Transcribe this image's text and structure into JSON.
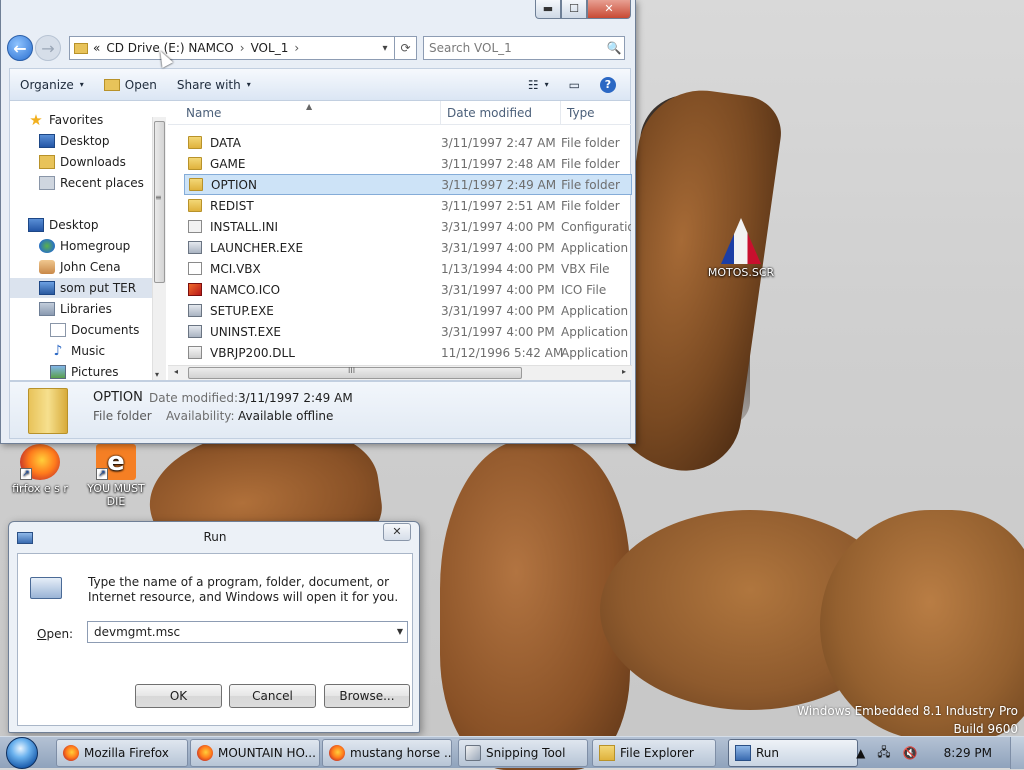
{
  "desktop": {
    "watermark": {
      "edition": "Windows Embedded 8.1 Industry Pro",
      "build": "Build 9600"
    },
    "icons": [
      {
        "label": "firfox e s r",
        "icon": "firefox-icon"
      },
      {
        "label": "YOU MUST DIE",
        "icon": "ie-icon"
      },
      {
        "label": "MOTOS.SCR",
        "icon": "screensaver-icon"
      }
    ]
  },
  "explorer": {
    "title_buttons": {
      "minimize": "▬",
      "maximize": "☐",
      "close": "✕"
    },
    "address": {
      "overflow": "«",
      "crumbs": [
        "CD Drive (E:) NAMCO",
        "VOL_1"
      ],
      "separator": "›",
      "dropdown": "▾",
      "refresh": "⟳"
    },
    "search": {
      "placeholder": "Search VOL_1",
      "icon": "🔍"
    },
    "toolbar": {
      "organize": "Organize",
      "open": "Open",
      "share_with": "Share with",
      "caret": "▾",
      "view_icon": "☷",
      "pane_icon": "▭",
      "help": "?"
    },
    "nav": {
      "favorites": "Favorites",
      "desktop": "Desktop",
      "downloads": "Downloads",
      "recent_places": "Recent places",
      "desktop2": "Desktop",
      "homegroup": "Homegroup",
      "user": "John Cena",
      "computer": "som put TER",
      "libraries": "Libraries",
      "documents": "Documents",
      "music": "Music",
      "pictures": "Pictures"
    },
    "columns": {
      "name": "Name",
      "date": "Date modified",
      "type": "Type",
      "sort_arrow": "▲"
    },
    "files": [
      {
        "name": "DATA",
        "date": "3/11/1997 2:47 AM",
        "type": "File folder",
        "kind": "folder"
      },
      {
        "name": "GAME",
        "date": "3/11/1997 2:48 AM",
        "type": "File folder",
        "kind": "folder"
      },
      {
        "name": "OPTION",
        "date": "3/11/1997 2:49 AM",
        "type": "File folder",
        "kind": "folder"
      },
      {
        "name": "REDIST",
        "date": "3/11/1997 2:51 AM",
        "type": "File folder",
        "kind": "folder"
      },
      {
        "name": "INSTALL.INI",
        "date": "3/31/1997 4:00 PM",
        "type": "Configuratio",
        "kind": "ini"
      },
      {
        "name": "LAUNCHER.EXE",
        "date": "3/31/1997 4:00 PM",
        "type": "Application",
        "kind": "exe"
      },
      {
        "name": "MCI.VBX",
        "date": "1/13/1994 4:00 PM",
        "type": "VBX File",
        "kind": "vbx"
      },
      {
        "name": "NAMCO.ICO",
        "date": "3/31/1997 4:00 PM",
        "type": "ICO File",
        "kind": "ico"
      },
      {
        "name": "SETUP.EXE",
        "date": "3/31/1997 4:00 PM",
        "type": "Application",
        "kind": "exe"
      },
      {
        "name": "UNINST.EXE",
        "date": "3/31/1997 4:00 PM",
        "type": "Application",
        "kind": "exe"
      },
      {
        "name": "VBRJP200.DLL",
        "date": "11/12/1996 5:42 AM",
        "type": "Application",
        "kind": "dll"
      }
    ],
    "selected_index": 2,
    "details": {
      "name": "OPTION",
      "type": "File folder",
      "date_label": "Date modified:",
      "date_value": "3/11/1997 2:49 AM",
      "avail_label": "Availability:",
      "avail_value": "Available offline"
    },
    "scroll": {
      "grip": "≡",
      "hgrip": "III",
      "left": "◂",
      "right": "▸",
      "down": "▾"
    }
  },
  "run": {
    "title": "Run",
    "close": "✕",
    "description": "Type the name of a program, folder, document, or Internet resource, and Windows will open it for you.",
    "open_label_u": "O",
    "open_label_rest": "pen:",
    "value": "devmgmt.msc",
    "dropdown": "▼",
    "ok": "OK",
    "cancel": "Cancel",
    "browse": "Browse..."
  },
  "taskbar": {
    "tasks": [
      {
        "label": "Mozilla Firefox",
        "icon": "firefox-icon"
      },
      {
        "label": "MOUNTAIN HO...",
        "icon": "firefox-icon"
      },
      {
        "label": "mustang horse ...",
        "icon": "firefox-icon"
      },
      {
        "label": "Snipping Tool",
        "icon": "snipping-tool-icon"
      },
      {
        "label": "File Explorer",
        "icon": "file-explorer-icon"
      },
      {
        "label": "Run",
        "icon": "run-icon"
      }
    ],
    "tray": {
      "up": "▲",
      "network": "🖧",
      "volume": "🔇",
      "time": "8:29 PM"
    }
  }
}
